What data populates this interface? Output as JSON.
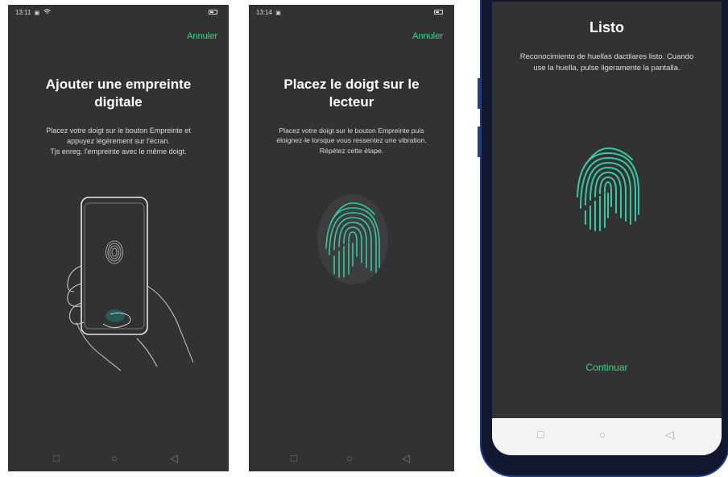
{
  "screen1": {
    "time": "13:11",
    "cancel": "Annuler",
    "title_line1": "Ajouter une empreinte",
    "title_line2": "digitale",
    "desc_line1": "Placez votre doigt sur le bouton Empreinte et",
    "desc_line2": "appuyez légèrement sur l'écran.",
    "desc_line3": "Tjs enreg. l'empreinte avec le même doigt."
  },
  "screen2": {
    "time": "13:14",
    "cancel": "Annuler",
    "title_line1": "Placez le doigt sur le",
    "title_line2": "lecteur",
    "desc_line1": "Placez votre doigt sur le bouton Empreinte puis",
    "desc_line2": "éloignez-le lorsque vous ressentez une vibration.",
    "desc_line3": "Répétez cette étape."
  },
  "screen3": {
    "title": "Listo",
    "desc_line1": "Reconocimiento de huellas dactilares listo. Cuando",
    "desc_line2": "use la huella, pulse ligeramente la pantalla.",
    "continue": "Continuar"
  },
  "nav": {
    "recent": "□",
    "home": "○",
    "back": "◁"
  },
  "colors": {
    "background": "#323232",
    "accent": "#3bd68a",
    "fingerprint": "#34c9a2"
  },
  "icons": [
    "battery-icon",
    "wifi-icon",
    "fingerprint-icon",
    "hand-phone-illustration"
  ]
}
